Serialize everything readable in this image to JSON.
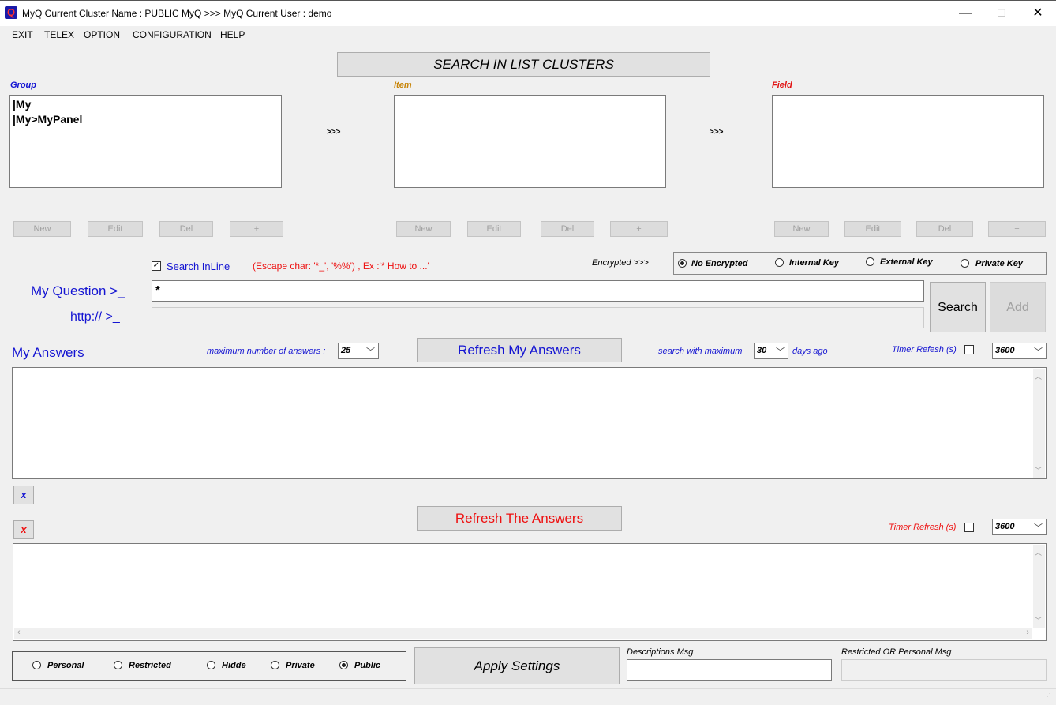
{
  "window": {
    "title": "MyQ Current Cluster Name : PUBLIC MyQ >>> MyQ Current User : demo",
    "app_icon": "Q",
    "minimize": "—",
    "maximize": "☐",
    "close": "✕"
  },
  "menu": [
    "EXIT",
    "TELEX",
    "OPTION",
    "CONFIGURATION",
    "HELP"
  ],
  "search_clusters_button": "SEARCH IN LIST CLUSTERS",
  "group": {
    "label": "Group",
    "items": [
      "|My",
      "|My>MyPanel"
    ]
  },
  "item": {
    "label": "Item",
    "items": []
  },
  "field": {
    "label": "Field",
    "items": []
  },
  "arrows": ">>>",
  "list_buttons": {
    "new": "New",
    "edit": "Edit",
    "del": "Del",
    "plus": "+"
  },
  "search_inline": {
    "label": "Search InLine",
    "checked": true
  },
  "escape_hint": "(Escape char: '*_', '%%') , Ex :'* How to ...'",
  "encrypted_label": "Encrypted >>>",
  "encryption_options": [
    {
      "label": "No Encrypted",
      "selected": true
    },
    {
      "label": "Internal Key",
      "selected": false
    },
    {
      "label": "External Key",
      "selected": false
    },
    {
      "label": "Private Key",
      "selected": false
    }
  ],
  "question": {
    "label": "My Question >_",
    "value": "*"
  },
  "url": {
    "label": "http:// >_",
    "value": ""
  },
  "search_button": "Search",
  "add_button": "Add",
  "my_answers": {
    "label": "My Answers",
    "max_label": "maximum number of answers :",
    "max_value": "25",
    "refresh_button": "Refresh My Answers",
    "search_with_label": "search with maximum",
    "days_value": "30",
    "days_label": "days ago",
    "timer_label": "Timer Refesh (s)",
    "timer_checked": false,
    "timer_value": "3600",
    "clear_button": "x"
  },
  "answers": {
    "refresh_button": "Refresh The Answers",
    "timer_label": "Timer Refresh (s)",
    "timer_checked": false,
    "timer_value": "3600",
    "clear_button": "x"
  },
  "visibility_options": [
    {
      "label": "Personal",
      "selected": false
    },
    {
      "label": "Restricted",
      "selected": false
    },
    {
      "label": "Hidde",
      "selected": false
    },
    {
      "label": "Private",
      "selected": false
    },
    {
      "label": "Public",
      "selected": true
    }
  ],
  "apply_button": "Apply Settings",
  "descriptions_label": "Descriptions Msg",
  "descriptions_value": "",
  "restricted_label": "Restricted OR Personal Msg",
  "restricted_value": "",
  "colors": {
    "blue_text": "#1414d2",
    "red_text": "#ee1111",
    "item_label": "#c8860b",
    "field_label": "#e11111"
  }
}
